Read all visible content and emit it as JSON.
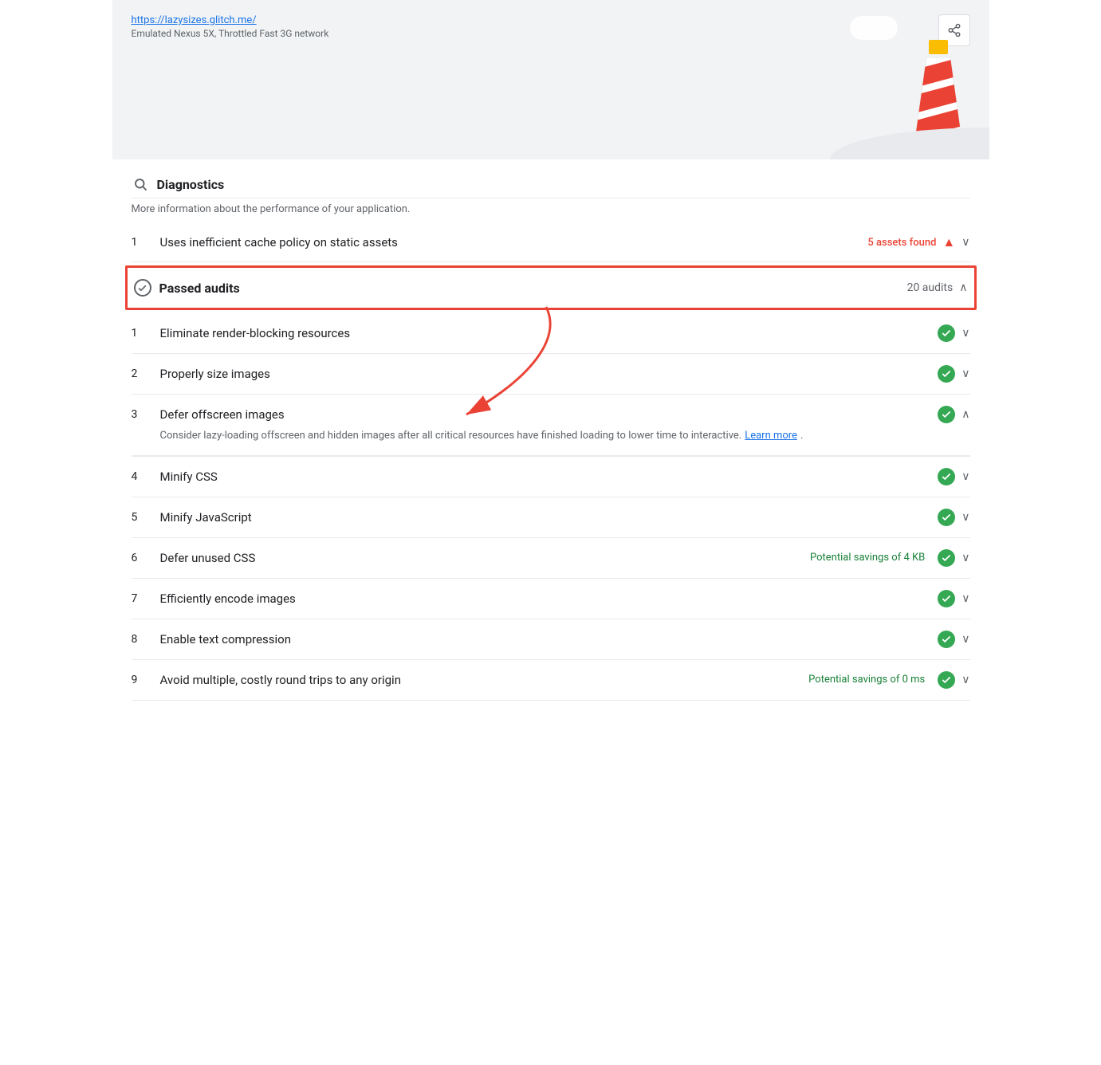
{
  "header": {
    "url": "https://lazysizes.glitch.me/",
    "subtitle": "Emulated Nexus 5X, Throttled Fast 3G network",
    "share_label": "share"
  },
  "diagnostics": {
    "section_title": "Diagnostics",
    "section_desc": "More information about the performance of your application.",
    "items": [
      {
        "number": "1",
        "label": "Uses inefficient cache policy on static assets",
        "assets_found": "5 assets found",
        "status": "warning"
      }
    ]
  },
  "passed_audits": {
    "label": "Passed audits",
    "count": "20 audits",
    "items": [
      {
        "number": "1",
        "label": "Eliminate render-blocking resources",
        "status": "passed",
        "savings": ""
      },
      {
        "number": "2",
        "label": "Properly size images",
        "status": "passed",
        "savings": ""
      },
      {
        "number": "3",
        "label": "Defer offscreen images",
        "status": "passed",
        "savings": "",
        "expanded": true,
        "detail": "Consider lazy-loading offscreen and hidden images after all critical resources have finished loading to lower time to interactive.",
        "learn_more": "Learn more"
      },
      {
        "number": "4",
        "label": "Minify CSS",
        "status": "passed",
        "savings": ""
      },
      {
        "number": "5",
        "label": "Minify JavaScript",
        "status": "passed",
        "savings": ""
      },
      {
        "number": "6",
        "label": "Defer unused CSS",
        "status": "passed",
        "savings": "Potential savings of 4 KB"
      },
      {
        "number": "7",
        "label": "Efficiently encode images",
        "status": "passed",
        "savings": ""
      },
      {
        "number": "8",
        "label": "Enable text compression",
        "status": "passed",
        "savings": ""
      },
      {
        "number": "9",
        "label": "Avoid multiple, costly round trips to any origin",
        "status": "passed",
        "savings": "Potential savings of 0 ms"
      }
    ]
  },
  "icons": {
    "search": "🔍",
    "warning": "▲",
    "chevron_down": "∨",
    "chevron_up": "∧",
    "checkmark": "✓"
  }
}
